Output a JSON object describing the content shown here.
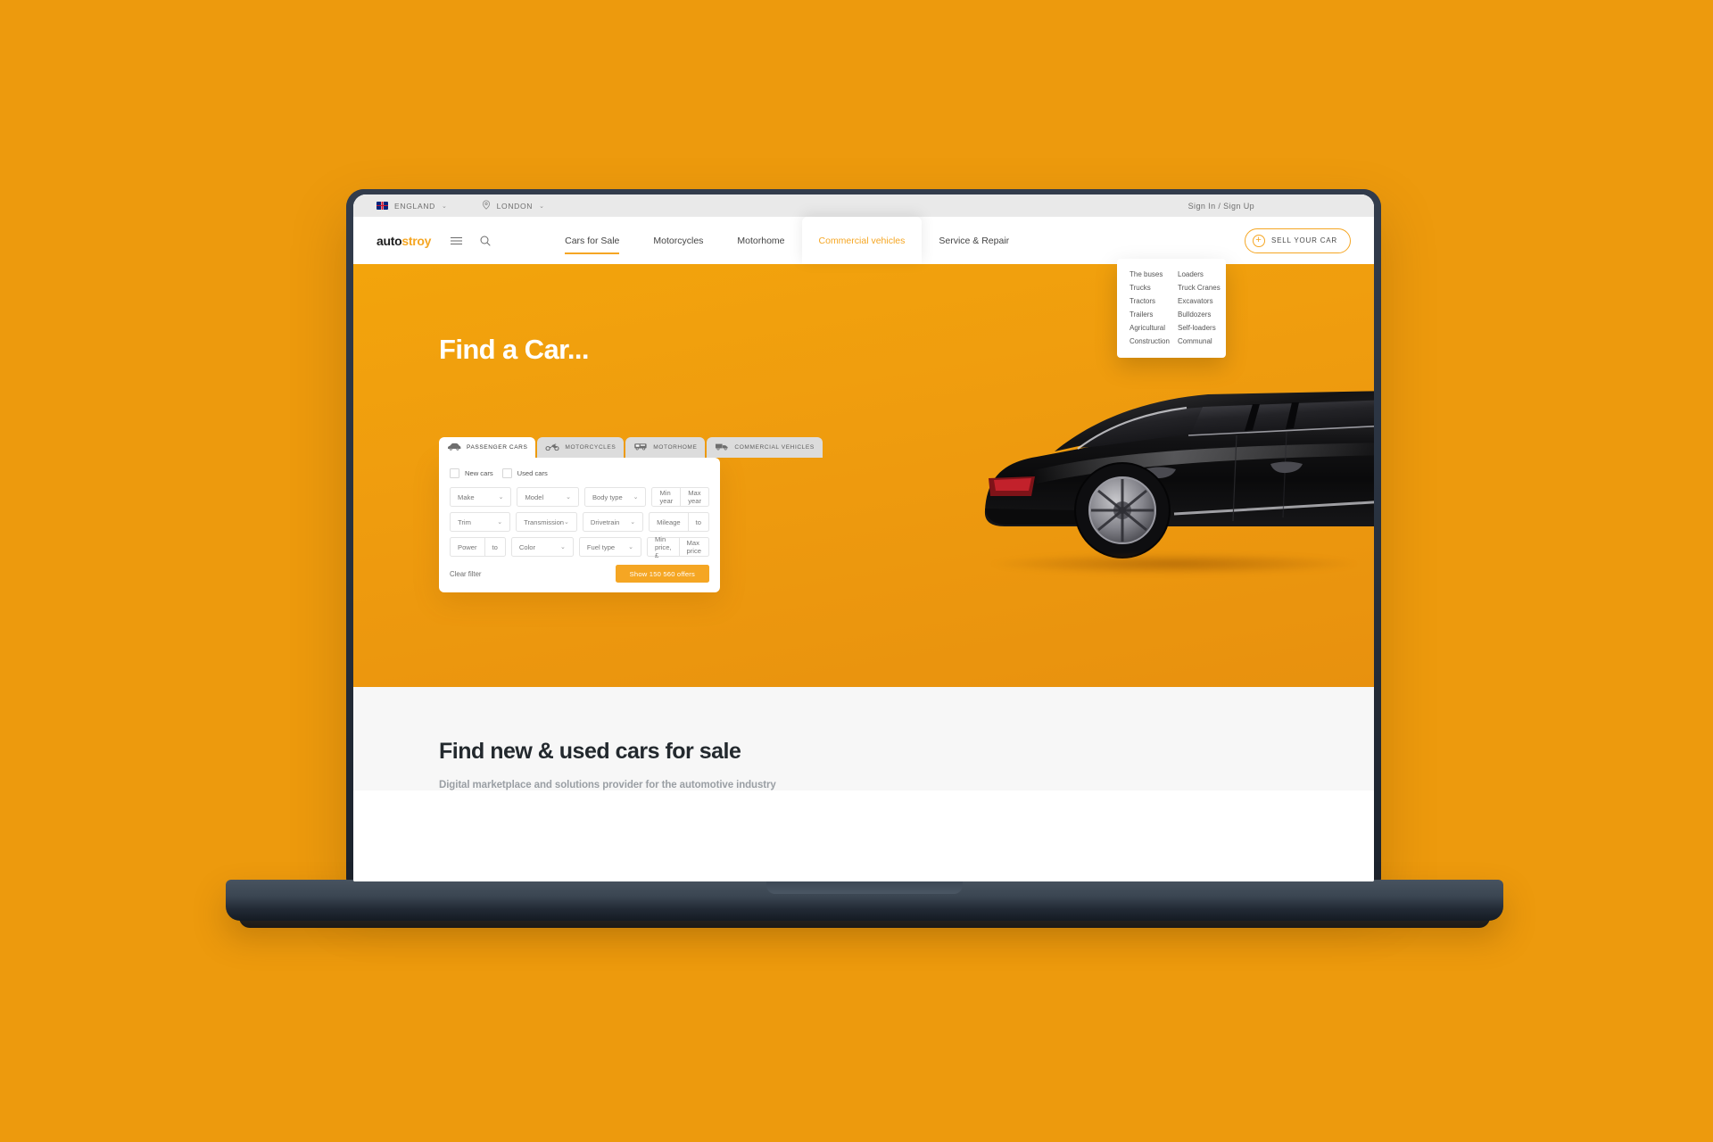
{
  "topbar": {
    "country": "ENGLAND",
    "city": "LONDON",
    "caret": "⌄",
    "auth": "Sign In / Sign Up",
    "flag_icon": "uk-flag-icon",
    "pin_icon": "location-pin-icon"
  },
  "header": {
    "logo_main": "auto",
    "logo_accent": "stroy",
    "menu_icon": "hamburger-menu-icon",
    "search_icon": "search-icon",
    "nav": [
      {
        "label": "Cars for Sale",
        "state": "underlined"
      },
      {
        "label": "Motorcycles",
        "state": "default"
      },
      {
        "label": "Motorhome",
        "state": "default"
      },
      {
        "label": "Commercial vehicles",
        "state": "open"
      },
      {
        "label": "Service & Repair",
        "state": "default"
      }
    ],
    "sell_button": "SELL YOUR CAR",
    "sell_icon": "plus-circle-icon",
    "plus_glyph": "+"
  },
  "dropdown": {
    "col_left": [
      "The buses",
      "Trucks",
      "Tractors",
      "Trailers",
      "Agricultural",
      "Construction"
    ],
    "col_right": [
      "Loaders",
      "Truck Cranes",
      "Excavators",
      "Bulldozers",
      "Self-loaders",
      "Communal"
    ]
  },
  "hero": {
    "title": "Find a Car...",
    "car_image": "black-luxury-sedan-rear-view"
  },
  "search": {
    "tabs": [
      {
        "label": "PASSENGER CARS",
        "icon": "car-icon",
        "active": true
      },
      {
        "label": "MOTORCYCLES",
        "icon": "motorcycle-icon",
        "active": false
      },
      {
        "label": "MOTORHOME",
        "icon": "motorhome-icon",
        "active": false
      },
      {
        "label": "COMMERCIAL VEHICLES",
        "icon": "truck-icon",
        "active": false
      }
    ],
    "conditions": [
      {
        "label": "New cars",
        "checked": false
      },
      {
        "label": "Used cars",
        "checked": false
      }
    ],
    "rows": [
      {
        "make": "Make",
        "model": "Model",
        "body": "Body type",
        "min": "Min year",
        "max": "Max year"
      },
      {
        "make": "Trim",
        "model": "Transmission",
        "body": "Drivetrain",
        "min": "Mileage",
        "max": "to"
      },
      {
        "make": "Power",
        "make2": "to",
        "model": "Color",
        "body": "Fuel type",
        "min": "Min price, £",
        "max": "Max price"
      }
    ],
    "chevron": "⌄",
    "clear_filter": "Clear filter",
    "show_offers": "Show 150 560 offers"
  },
  "bottom": {
    "heading": "Find new & used cars for sale",
    "subheading": "Digital marketplace and solutions provider for the automotive industry"
  },
  "colors": {
    "page_background": "#ED9A0D",
    "accent": "#F5A623",
    "hero_top": "#F3A40C",
    "hero_bottom": "#E8910E",
    "laptop_body": "#2b3442",
    "bottom_section": "#f7f7f7"
  }
}
